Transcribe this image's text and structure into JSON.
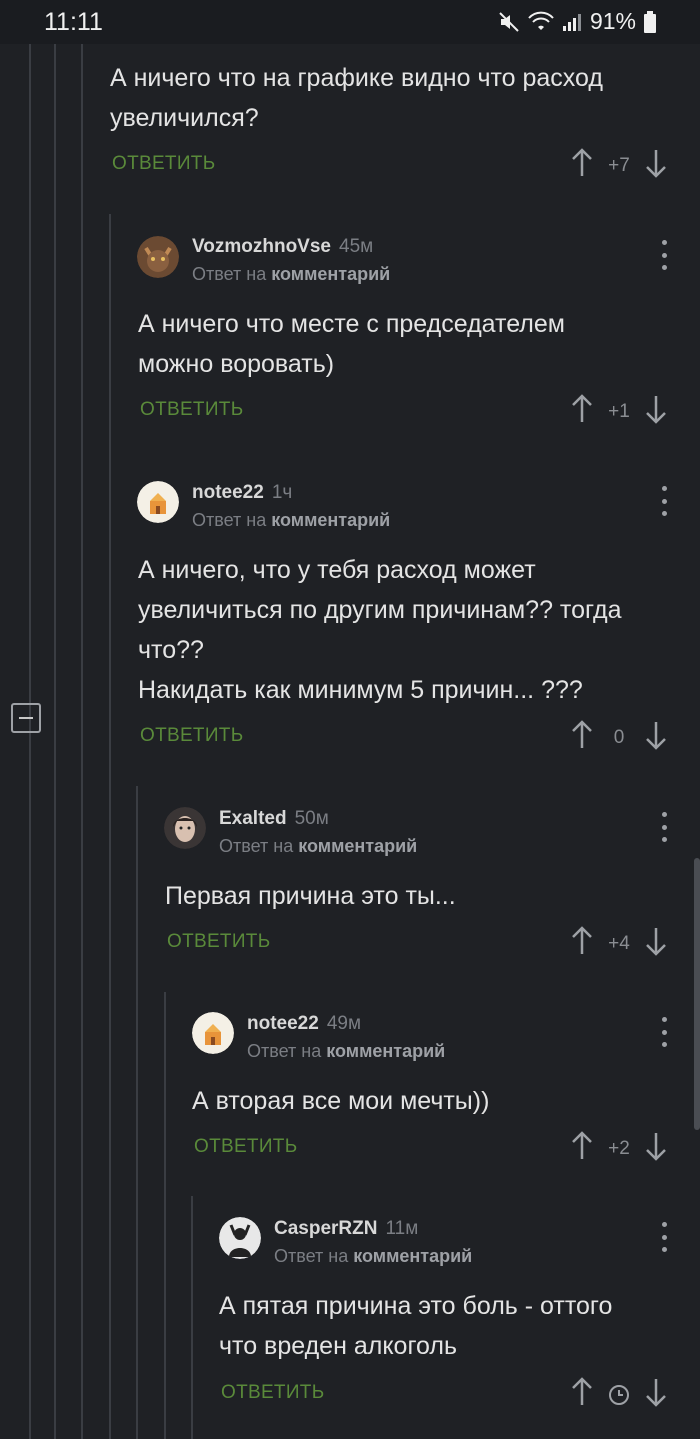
{
  "status_bar": {
    "time": "11:11",
    "battery": "91%"
  },
  "colors": {
    "background": "#1f2125",
    "reply_green": "#5a8a3a",
    "muted": "#7b7e84"
  },
  "top_comment": {
    "text": "А ничего что на графике видно что расход\nувеличился?",
    "reply_label": "ОТВЕТИТЬ",
    "votes": "+7"
  },
  "comments": [
    {
      "author": "VozmozhnoVse",
      "time": "45м",
      "reply_prefix": "Ответ на",
      "reply_target": "комментарий",
      "text": "А ничего что месте с председателем\nможно воровать)",
      "reply_label": "ОТВЕТИТЬ",
      "votes": "+1"
    },
    {
      "author": "notee22",
      "time": "1ч",
      "reply_prefix": "Ответ на",
      "reply_target": "комментарий",
      "text": "А ничего, что у тебя расход может\nувеличиться по другим причинам?? тогда\nчто??\nНакидать как минимум 5 причин...  ???",
      "reply_label": "ОТВЕТИТЬ",
      "votes": "0"
    },
    {
      "author": "Exalted",
      "time": "50м",
      "reply_prefix": "Ответ на",
      "reply_target": "комментарий",
      "text": "Первая причина это ты...",
      "reply_label": "ОТВЕТИТЬ",
      "votes": "+4"
    },
    {
      "author": "notee22",
      "time": "49м",
      "reply_prefix": "Ответ на",
      "reply_target": "комментарий",
      "text": "А вторая все мои мечты))",
      "reply_label": "ОТВЕТИТЬ",
      "votes": "+2"
    },
    {
      "author": "CasperRZN",
      "time": "11м",
      "reply_prefix": "Ответ на",
      "reply_target": "комментарий",
      "text": "А пятая причина это боль - оттого\nчто вреден алкоголь",
      "reply_label": "ОТВЕТИТЬ",
      "votes": "clock-icon"
    }
  ]
}
